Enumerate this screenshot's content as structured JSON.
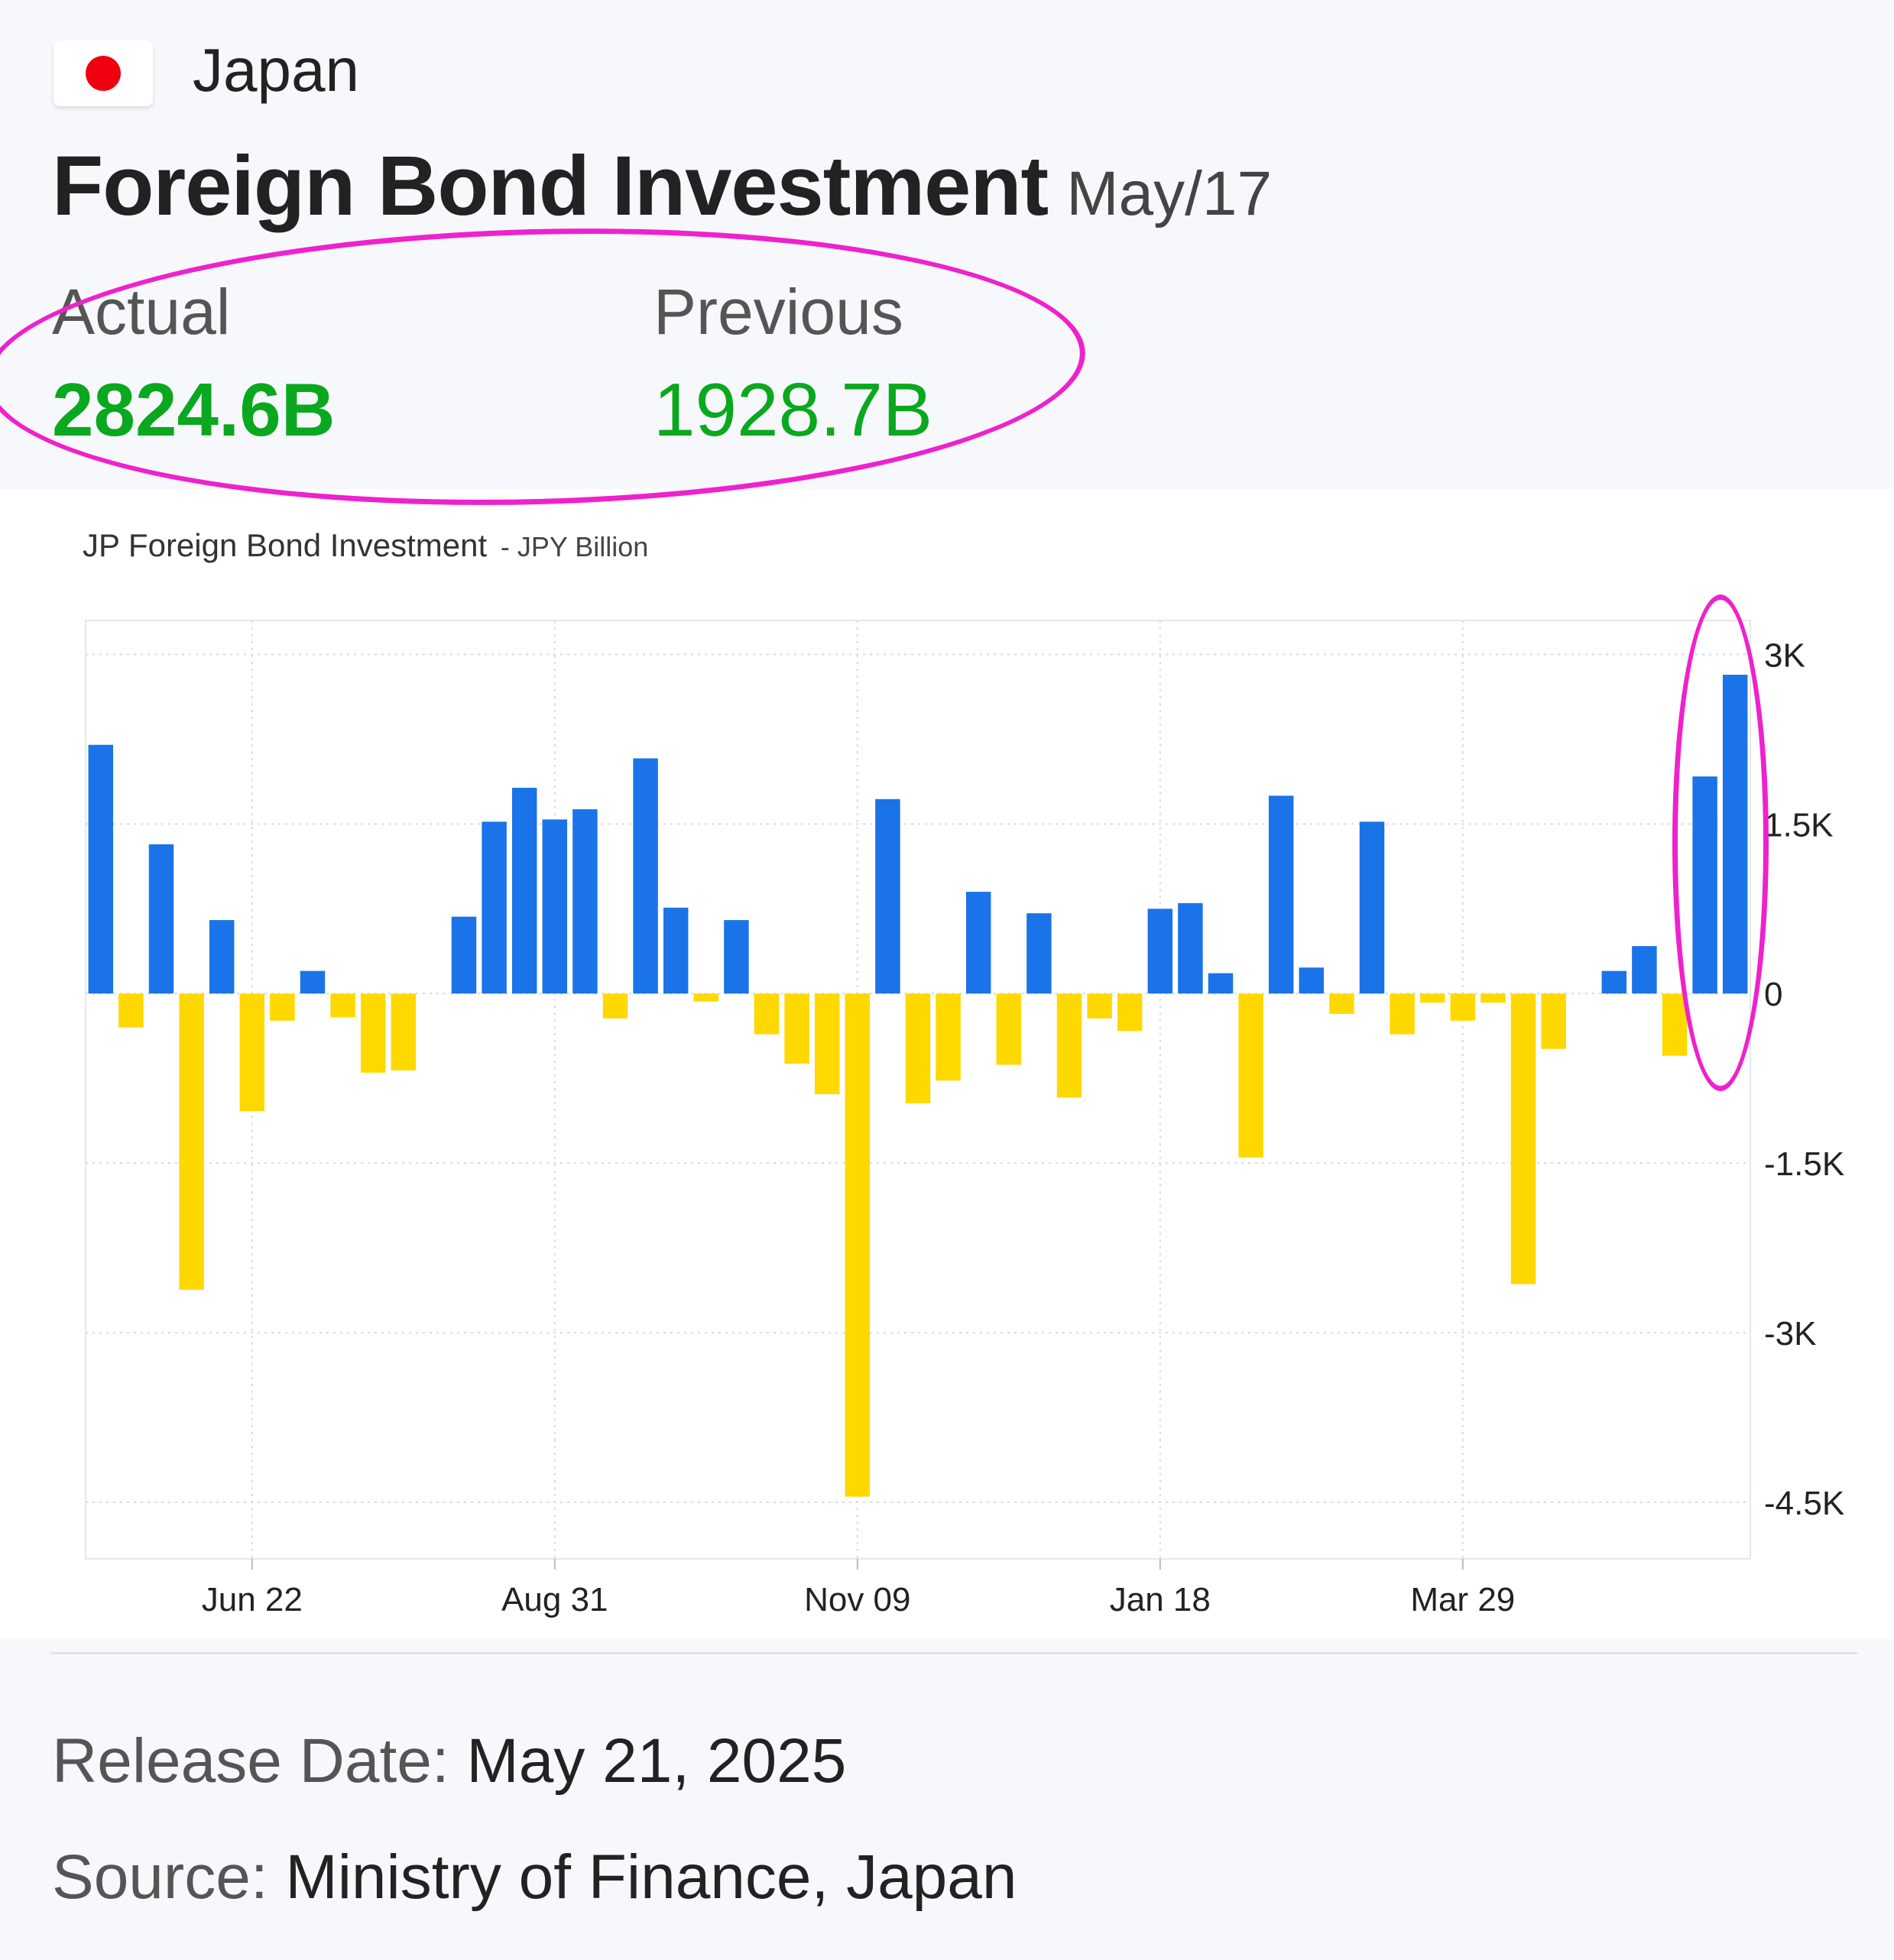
{
  "header": {
    "country": "Japan",
    "title": "Foreign Bond Investment",
    "period": "May/17",
    "flag_color": "#ee0011"
  },
  "kpis": {
    "actual_label": "Actual",
    "actual_value": "2824.6B",
    "previous_label": "Previous",
    "previous_value": "1928.7B",
    "value_color": "#0aa81e"
  },
  "chart_data": {
    "type": "bar",
    "title": "JP Foreign Bond Investment",
    "unit": "- JPY Billion",
    "ylim": [
      -5000,
      3300
    ],
    "yticks": [
      3000,
      1500,
      0,
      -1500,
      -3000,
      -4500
    ],
    "ytick_labels": [
      "3K",
      "1.5K",
      "0",
      "-1.5K",
      "-3K",
      "-4.5K"
    ],
    "xtick_labels": [
      "Jun 22",
      "Aug 31",
      "Nov 09",
      "Jan 18",
      "Mar 29"
    ],
    "xtick_index": [
      5.5,
      15.5,
      25.5,
      35.5,
      45.5
    ],
    "grid": true,
    "positive_color": "#1a73e8",
    "negative_color": "#ffd800",
    "values": [
      2200,
      -300,
      1320,
      -2620,
      650,
      -1040,
      -240,
      200,
      -210,
      -700,
      -680,
      0,
      680,
      1520,
      1820,
      1540,
      1630,
      -220,
      2080,
      760,
      -70,
      650,
      -360,
      -620,
      -890,
      -4450,
      1720,
      -970,
      -770,
      900,
      -630,
      710,
      -920,
      -220,
      -330,
      750,
      800,
      180,
      -1450,
      1750,
      230,
      -180,
      1520,
      -360,
      -80,
      -240,
      -80,
      -2570,
      -490,
      0,
      200,
      420,
      -550,
      1920,
      2820
    ]
  },
  "footer": {
    "release_label": "Release Date: ",
    "release_value": "May 21, 2025",
    "source_label": "Source: ",
    "source_value": "Ministry of Finance, Japan"
  },
  "highlight_color": "#ee22cc"
}
